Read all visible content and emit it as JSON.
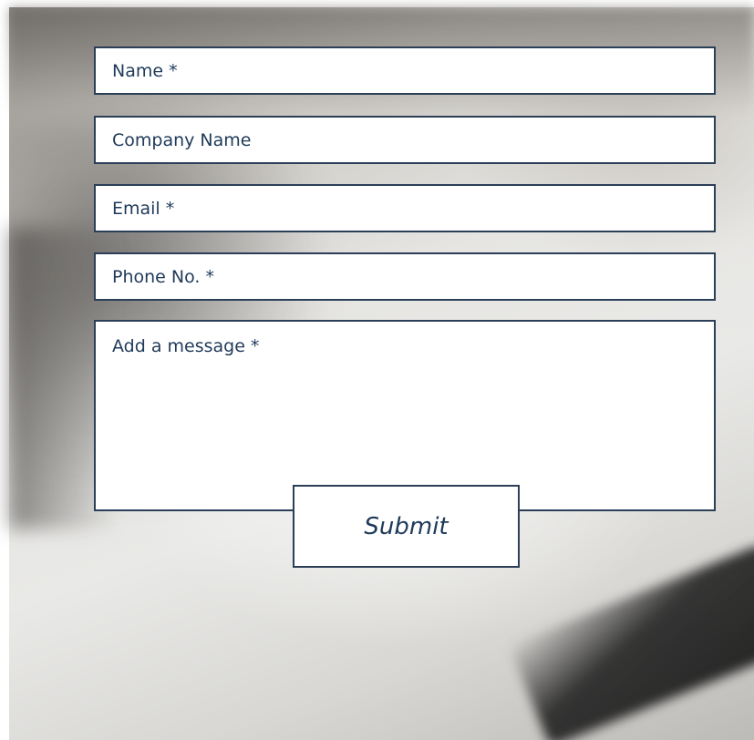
{
  "form": {
    "fields": [
      {
        "placeholder": "Name *"
      },
      {
        "placeholder": "Company Name"
      },
      {
        "placeholder": "Email *"
      },
      {
        "placeholder": "Phone No. *"
      }
    ],
    "message": {
      "placeholder": "Add a message *"
    },
    "submit_label": "Submit"
  },
  "colors": {
    "border": "#2b3f57",
    "text": "#1f3a5a",
    "field_background": "#ffffff"
  }
}
